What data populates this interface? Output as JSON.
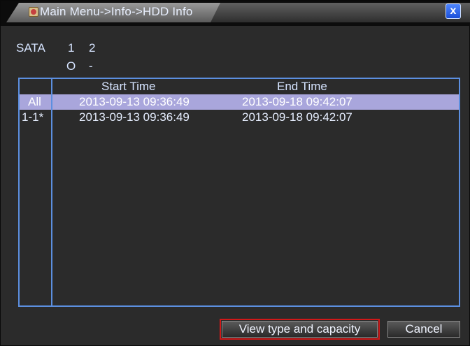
{
  "window": {
    "title": "Main Menu->Info->HDD Info",
    "close_glyph": "x"
  },
  "sata": {
    "label": "SATA",
    "drives": [
      "1",
      "2"
    ],
    "status": [
      "O",
      "-"
    ]
  },
  "table": {
    "columns": [
      "Start Time",
      "End Time"
    ],
    "rows": [
      {
        "id": "All",
        "start": "2013-09-13 09:36:49",
        "end": "2013-09-18 09:42:07",
        "selected": true
      },
      {
        "id": "1-1*",
        "start": "2013-09-13 09:36:49",
        "end": "2013-09-18 09:42:07",
        "selected": false
      }
    ]
  },
  "buttons": {
    "view": "View type and capacity",
    "cancel": "Cancel"
  },
  "colors": {
    "border_accent": "#5c8fe0",
    "selection": "#a9a6dc",
    "highlight_outline": "#d01818"
  }
}
